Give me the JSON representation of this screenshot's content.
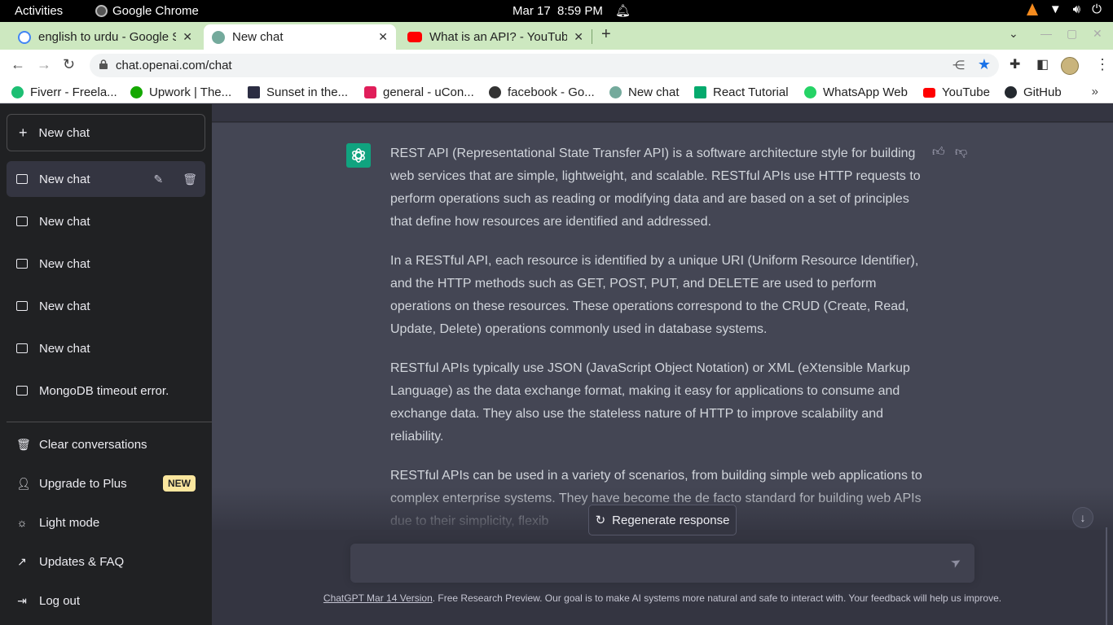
{
  "os_bar": {
    "activities": "Activities",
    "app_name": "Google Chrome",
    "date": "Mar 17",
    "time": "8:59 PM"
  },
  "tabs": [
    {
      "label": "english to urdu - Google S",
      "active": false
    },
    {
      "label": "New chat",
      "active": true
    },
    {
      "label": "What is an API? - YouTube",
      "active": false
    }
  ],
  "address_bar": {
    "url": "chat.openai.com/chat"
  },
  "bookmarks": [
    {
      "label": "Fiverr - Freela...",
      "color": "#1dbf73"
    },
    {
      "label": "Upwork | The...",
      "color": "#14a800"
    },
    {
      "label": "Sunset in the...",
      "color": "#2b2d42"
    },
    {
      "label": "general - uCon...",
      "color": "#e01e5a"
    },
    {
      "label": "facebook - Go...",
      "color": "#333333"
    },
    {
      "label": "New chat",
      "color": "#74aa9c"
    },
    {
      "label": "React Tutorial",
      "color": "#04aa6d"
    },
    {
      "label": "WhatsApp Web",
      "color": "#25d366"
    },
    {
      "label": "YouTube",
      "color": "#ff0000"
    },
    {
      "label": "GitHub",
      "color": "#24292f"
    }
  ],
  "sidebar": {
    "new_chat_label": "New chat",
    "conversations": [
      {
        "label": "New chat",
        "active": true
      },
      {
        "label": "New chat",
        "active": false
      },
      {
        "label": "New chat",
        "active": false
      },
      {
        "label": "New chat",
        "active": false
      },
      {
        "label": "New chat",
        "active": false
      },
      {
        "label": "MongoDB timeout error.",
        "active": false
      }
    ],
    "menu": {
      "clear": "Clear conversations",
      "upgrade": "Upgrade to Plus",
      "upgrade_badge": "NEW",
      "light_mode": "Light mode",
      "updates": "Updates & FAQ",
      "logout": "Log out"
    }
  },
  "chat": {
    "paragraphs": [
      "REST API (Representational State Transfer API) is a software architecture style for building web services that are simple, lightweight, and scalable. RESTful APIs use HTTP requests to perform operations such as reading or modifying data and are based on a set of principles that define how resources are identified and addressed.",
      "In a RESTful API, each resource is identified by a unique URI (Uniform Resource Identifier), and the HTTP methods such as GET, POST, PUT, and DELETE are used to perform operations on these resources. These operations correspond to the CRUD (Create, Read, Update, Delete) operations commonly used in database systems.",
      "RESTful APIs typically use JSON (JavaScript Object Notation) or XML (eXtensible Markup Language) as the data exchange format, making it easy for applications to consume and exchange data. They also use the stateless nature of HTTP to improve scalability and reliability.",
      "RESTful APIs can be used in a variety of scenarios, from building simple web applications to complex enterprise systems. They have become the de facto standard for building web APIs due to their simplicity, flexib"
    ],
    "regenerate_label": "Regenerate response",
    "input_value": ""
  },
  "footer": {
    "version_link": "ChatGPT Mar 14 Version",
    "text": ". Free Research Preview. Our goal is to make AI systems more natural and safe to interact with. Your feedback will help us improve."
  },
  "colors": {
    "sidebar_bg": "#202123",
    "main_bg": "#343541",
    "message_bg": "#444654",
    "accent": "#10a37f",
    "tabstrip_bg": "#cde8c0"
  }
}
